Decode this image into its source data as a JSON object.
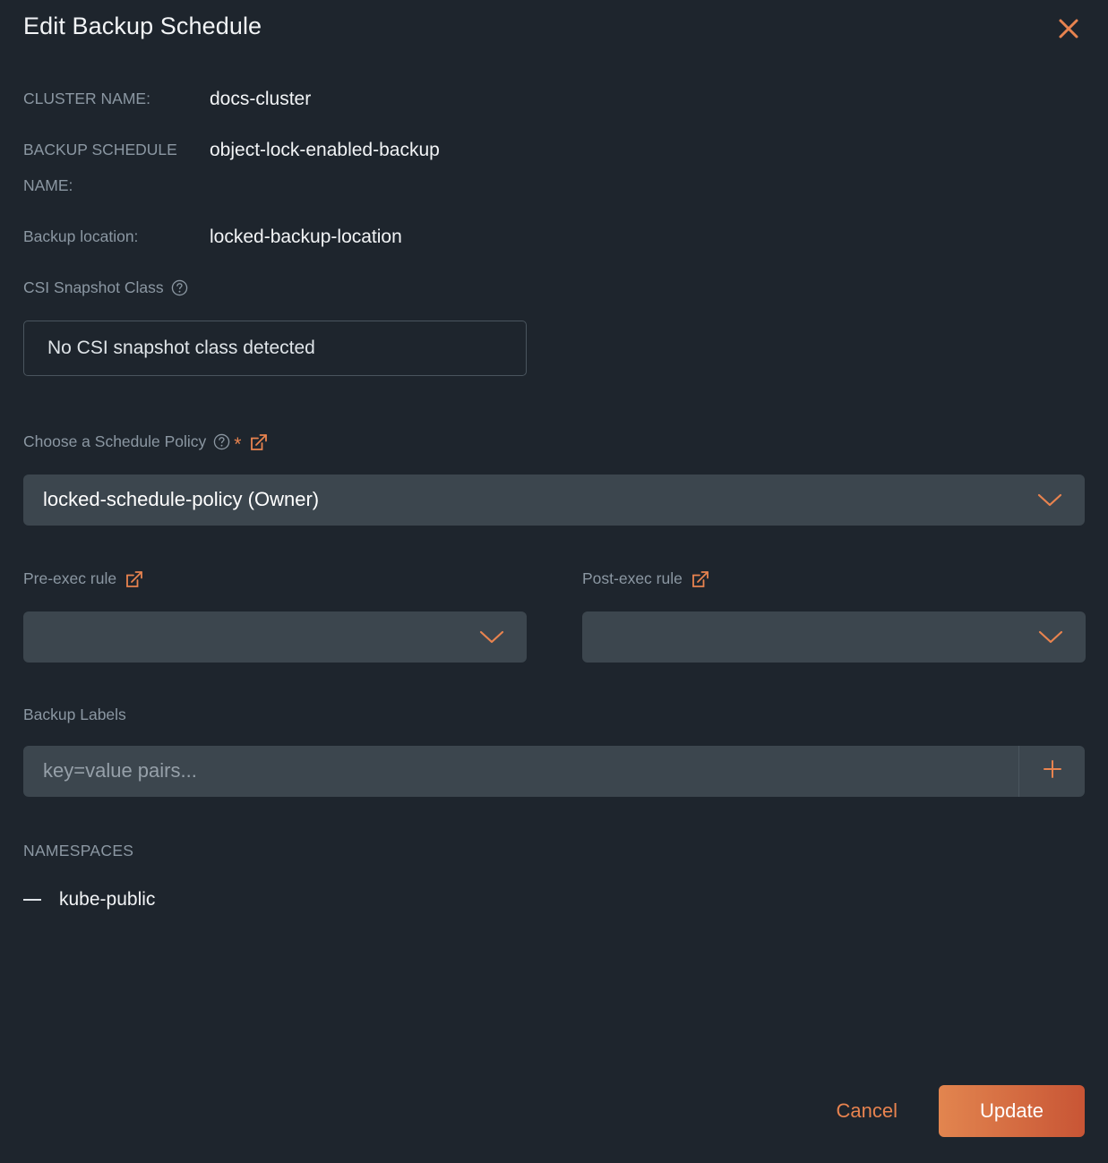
{
  "dialog": {
    "title": "Edit Backup Schedule",
    "close_icon": "close-icon"
  },
  "info": {
    "cluster_name_label": "CLUSTER NAME:",
    "cluster_name_value": "docs-cluster",
    "schedule_name_label": "BACKUP SCHEDULE NAME:",
    "schedule_name_value": "object-lock-enabled-backup",
    "backup_location_label": "Backup location:",
    "backup_location_value": "locked-backup-location"
  },
  "csi": {
    "label": "CSI Snapshot Class",
    "help_icon": "help-circle-icon",
    "value": "No CSI snapshot class detected"
  },
  "policy": {
    "label": "Choose a Schedule Policy",
    "help_icon": "help-circle-icon",
    "required_marker": "*",
    "external_link_icon": "external-link-icon",
    "value": "locked-schedule-policy (Owner)",
    "chevron_icon": "chevron-down-icon"
  },
  "pre_exec": {
    "label": "Pre-exec rule",
    "external_link_icon": "external-link-icon",
    "value": "",
    "chevron_icon": "chevron-down-icon"
  },
  "post_exec": {
    "label": "Post-exec rule",
    "external_link_icon": "external-link-icon",
    "value": "",
    "chevron_icon": "chevron-down-icon"
  },
  "backup_labels": {
    "label": "Backup Labels",
    "placeholder": "key=value pairs...",
    "value": "",
    "add_icon": "plus-icon"
  },
  "namespaces": {
    "title": "NAMESPACES",
    "items": [
      {
        "name": "kube-public"
      }
    ]
  },
  "footer": {
    "cancel_label": "Cancel",
    "update_label": "Update"
  },
  "colors": {
    "background": "#1e252d",
    "accent": "#e8834f",
    "field_fill": "#3c464e",
    "label_text": "#8b97a2",
    "value_text": "#f2f4f6",
    "button_gradient_start": "#e2854f",
    "button_gradient_end": "#c85535"
  }
}
